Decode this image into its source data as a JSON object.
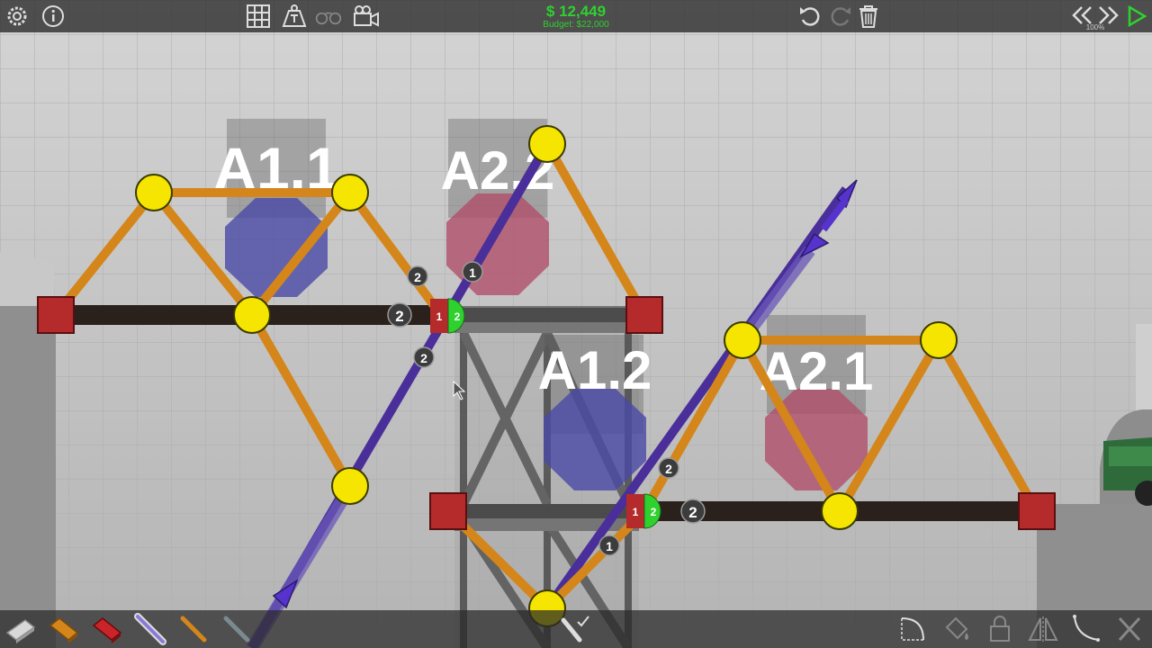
{
  "hud": {
    "money": "$ 12,449",
    "budget": "Budget: $22,000",
    "speed": "100%"
  },
  "colors": {
    "road": "#2a201c",
    "wood": "#d4861a",
    "joint": "#f5e500",
    "anchor": "#b52a2a",
    "hydraulic": "#4a2f9a",
    "blue_zone": "#4a4aa6",
    "pink_zone": "#b0506a",
    "toggle_green": "#2fd12f",
    "money_green": "#2fd12f"
  },
  "zones": [
    {
      "label": "A1.1",
      "color": "blue"
    },
    {
      "label": "A2.2",
      "color": "pink"
    },
    {
      "label": "A1.2",
      "color": "blue"
    },
    {
      "label": "A2.1",
      "color": "pink"
    }
  ],
  "phase_badges": [
    "2",
    "1",
    "2",
    "2",
    "2",
    "1",
    "2"
  ],
  "split_joints": [
    {
      "left": "1",
      "right": "2"
    },
    {
      "left": "1",
      "right": "2"
    }
  ],
  "top_left_icons": [
    "gear-icon",
    "info-icon"
  ],
  "top_center_icons": [
    "grid-icon",
    "weight-icon",
    "binoculars-icon",
    "camera-icon"
  ],
  "top_right_icons": [
    "undo-icon",
    "redo-icon",
    "trash-icon",
    "rewind-icon",
    "fast-forward-icon",
    "play-icon"
  ],
  "material_icons": [
    "road-material-icon",
    "wood-material-icon",
    "reinforced-road-icon",
    "hydraulic-icon",
    "rope-icon",
    "steel-icon",
    "hydraulic-controller-icon"
  ],
  "tool_icons": [
    "spline-icon",
    "paint-icon",
    "lock-icon",
    "mirror-icon",
    "curve-icon",
    "close-icon"
  ]
}
